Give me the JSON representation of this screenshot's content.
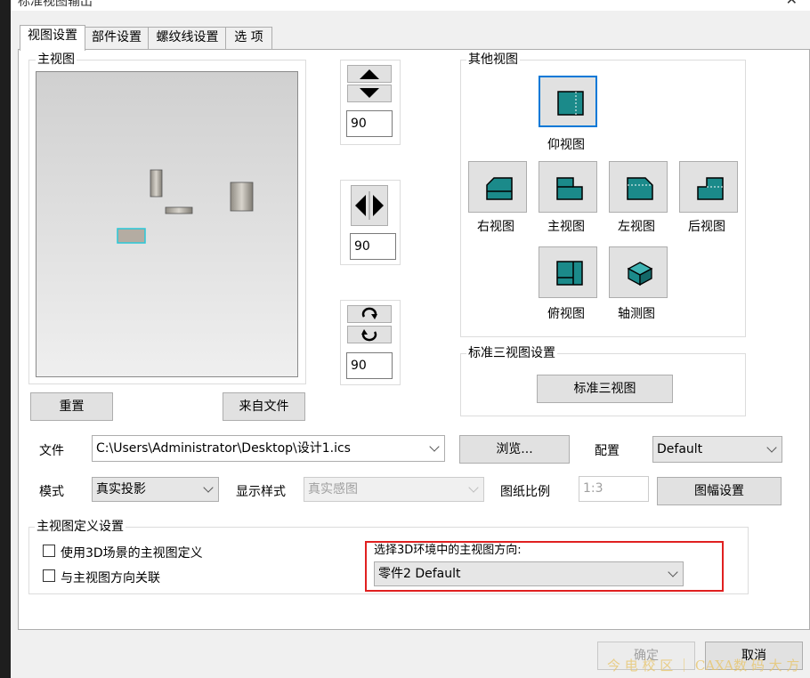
{
  "window": {
    "title": "标准视图输出",
    "close": "✕"
  },
  "tabs": [
    "视图设置",
    "部件设置",
    "螺纹线设置",
    "选 项"
  ],
  "main_view": {
    "title": "主视图"
  },
  "rotate": {
    "vertical_value": "90",
    "horizontal_value": "90",
    "spin_value": "90"
  },
  "buttons": {
    "reset": "重置",
    "from_file": "来自文件",
    "browse": "浏览...",
    "standard_three": "标准三视图",
    "sheet_setup": "图幅设置",
    "ok": "确定",
    "cancel": "取消"
  },
  "other_views": {
    "title": "其他视图",
    "items": [
      {
        "label": "仰视图",
        "icon": "bottom-view-icon"
      },
      {
        "label": "右视图",
        "icon": "right-view-icon"
      },
      {
        "label": "主视图",
        "icon": "front-view-icon"
      },
      {
        "label": "左视图",
        "icon": "left-view-icon"
      },
      {
        "label": "后视图",
        "icon": "back-view-icon"
      },
      {
        "label": "俯视图",
        "icon": "top-view-icon"
      },
      {
        "label": "轴测图",
        "icon": "isometric-view-icon"
      }
    ]
  },
  "standard_three_group": {
    "title": "标准三视图设置"
  },
  "file": {
    "label": "文件",
    "value": "C:\\Users\\Administrator\\Desktop\\设计1.ics"
  },
  "config": {
    "label": "配置",
    "value": "Default"
  },
  "mode": {
    "label": "模式",
    "value": "真实投影"
  },
  "display_style": {
    "label": "显示样式",
    "value": "真实感图"
  },
  "scale": {
    "label": "图纸比例",
    "value": "1:3"
  },
  "main_view_def": {
    "title": "主视图定义设置",
    "use_3d_def": "使用3D场景的主视图定义",
    "link_direction": "与主视图方向关联",
    "direction_label": "选择3D环境中的主视图方向:",
    "direction_value": "零件2  Default"
  },
  "watermark": "今 电 校 区 ｜ CAXA数 码 大 方",
  "colors": {
    "teal": "#1b8a8a",
    "highlight_red": "#e02020",
    "selection_blue": "#0078d7"
  }
}
